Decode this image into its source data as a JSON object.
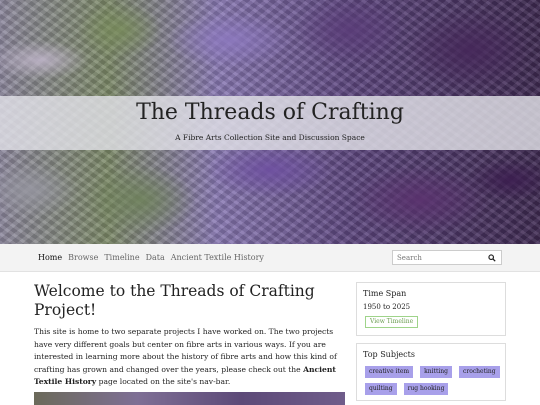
{
  "site": {
    "title": "The Threads of Crafting",
    "subtitle": "A Fibre Arts Collection Site and Discussion Space"
  },
  "nav": {
    "items": [
      {
        "label": "Home",
        "active": true
      },
      {
        "label": "Browse"
      },
      {
        "label": "Timeline"
      },
      {
        "label": "Data"
      },
      {
        "label": "Ancient Textile History"
      }
    ],
    "search_placeholder": "Search",
    "search_icon": "magnifier-icon"
  },
  "main": {
    "title": "Welcome to the Threads of Crafting Project!",
    "intro_before": "This site is home to two separate projects I have worked on. The two projects have very different goals but center on fibre arts in various ways. If you are interested in learning more about the history of fibre arts and how this kind of crafting has grown and changed over the years, please check out the ",
    "intro_link": "Ancient Textile History",
    "intro_after": " page located on the site's nav-bar."
  },
  "sidebar": {
    "timespan": {
      "title": "Time Span",
      "range": "1950 to 2025",
      "button": "View Timeline"
    },
    "subjects": {
      "title": "Top Subjects",
      "tags": [
        "creative item",
        "knitting",
        "crocheting",
        "quilting",
        "rug hooking"
      ]
    }
  },
  "colors": {
    "tag_bg": "#a8a0ea",
    "timeline_btn_border": "#9fd48a",
    "nav_bg": "#f3f3f3"
  }
}
